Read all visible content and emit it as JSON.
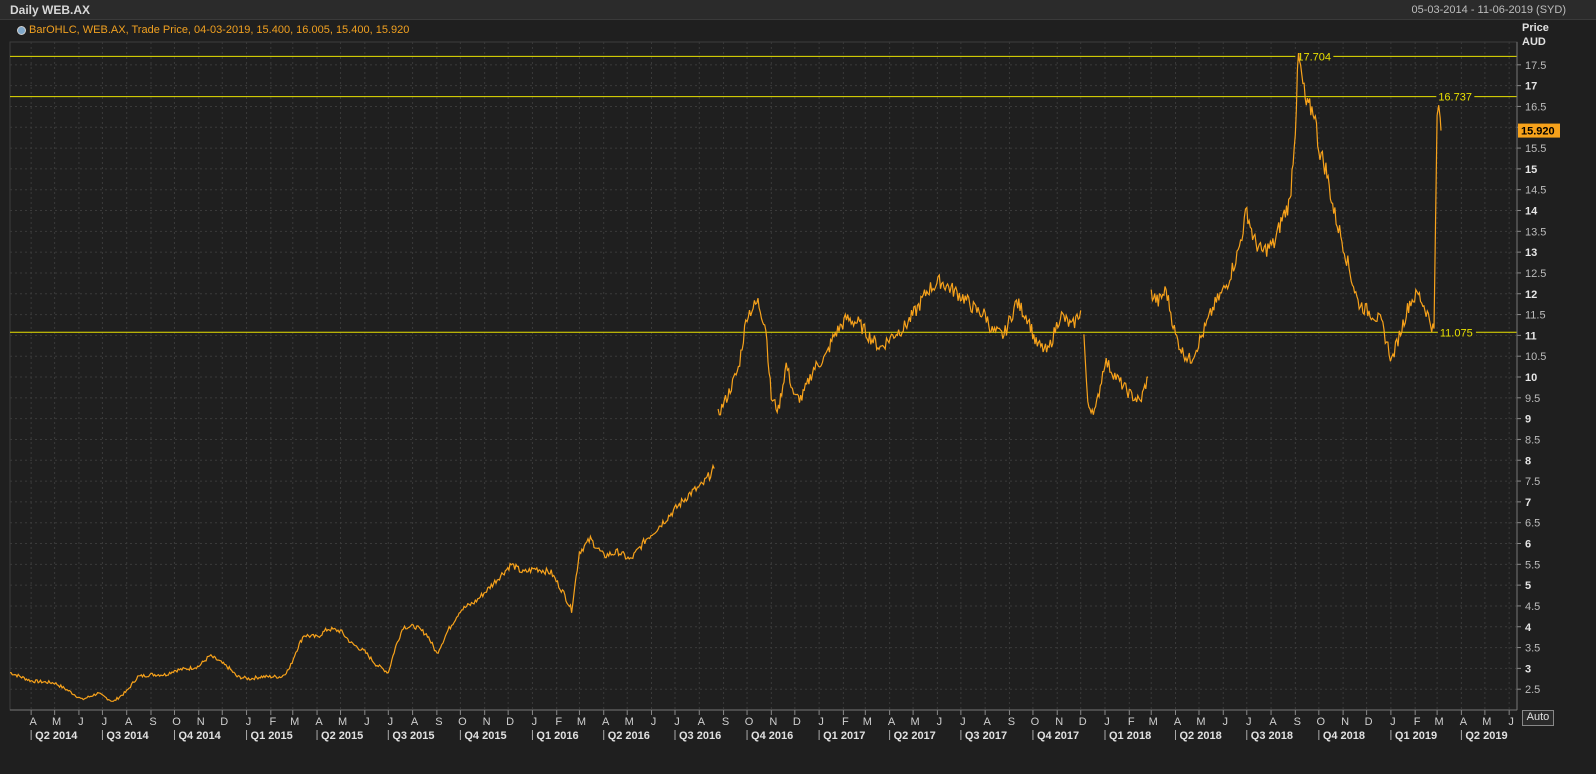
{
  "header": {
    "title": "Daily WEB.AX",
    "range": "05-03-2014 - 11-06-2019 (SYD)",
    "legend": "BarOHLC, WEB.AX, Trade Price, 04-03-2019, 15.400, 16.005, 15.400, 15.920"
  },
  "axis": {
    "price_label": "Price",
    "currency_label": "AUD",
    "auto_label": "Auto"
  },
  "colors": {
    "series": "#f7a21b",
    "hline": "#e8e000",
    "grid": "#3a3a3a",
    "background": "#1f1f1f",
    "last_price_bg": "#f7a21b"
  },
  "chart_data": {
    "type": "line",
    "title": "Daily WEB.AX",
    "series_name": "WEB.AX Trade Price",
    "ylim": [
      2,
      18
    ],
    "yticks": [
      2.5,
      3,
      3.5,
      4,
      4.5,
      5,
      5.5,
      6,
      6.5,
      7,
      7.5,
      8,
      8.5,
      9,
      9.5,
      10,
      10.5,
      11,
      11.5,
      12,
      12.5,
      13,
      13.5,
      14,
      14.5,
      15,
      15.5,
      16,
      16.5,
      17,
      17.5
    ],
    "ytick_labels": [
      "2.5",
      "3",
      "3.5",
      "4",
      "4.5",
      "5",
      "5.5",
      "6",
      "6.5",
      "7",
      "7.5",
      "8",
      "8.5",
      "9",
      "9.5",
      "10",
      "10.5",
      "11",
      "11.5",
      "12",
      "12.5",
      "13",
      "13.5",
      "14",
      "14.5",
      "15",
      "15.5",
      "16",
      "16.5",
      "17",
      "17.5"
    ],
    "last_price": 15.92,
    "last_price_label": "15.920",
    "hlines": [
      {
        "value": 17.704,
        "label": "17.704",
        "x": "2018-09-01"
      },
      {
        "value": 16.737,
        "label": "16.737",
        "x": "2019-02-28"
      },
      {
        "value": 11.075,
        "label": "11.075",
        "x": "2019-03-02"
      }
    ],
    "x_start": "2014-03-05",
    "x_end": "2019-06-11",
    "month_labels": [
      {
        "d": "2014-04-01",
        "l": "A"
      },
      {
        "d": "2014-05-01",
        "l": "M"
      },
      {
        "d": "2014-06-01",
        "l": "J"
      },
      {
        "d": "2014-07-01",
        "l": "J"
      },
      {
        "d": "2014-08-01",
        "l": "A"
      },
      {
        "d": "2014-09-01",
        "l": "S"
      },
      {
        "d": "2014-10-01",
        "l": "O"
      },
      {
        "d": "2014-11-01",
        "l": "N"
      },
      {
        "d": "2014-12-01",
        "l": "D"
      },
      {
        "d": "2015-01-01",
        "l": "J"
      },
      {
        "d": "2015-02-01",
        "l": "F"
      },
      {
        "d": "2015-03-01",
        "l": "M"
      },
      {
        "d": "2015-04-01",
        "l": "A"
      },
      {
        "d": "2015-05-01",
        "l": "M"
      },
      {
        "d": "2015-06-01",
        "l": "J"
      },
      {
        "d": "2015-07-01",
        "l": "J"
      },
      {
        "d": "2015-08-01",
        "l": "A"
      },
      {
        "d": "2015-09-01",
        "l": "S"
      },
      {
        "d": "2015-10-01",
        "l": "O"
      },
      {
        "d": "2015-11-01",
        "l": "N"
      },
      {
        "d": "2015-12-01",
        "l": "D"
      },
      {
        "d": "2016-01-01",
        "l": "J"
      },
      {
        "d": "2016-02-01",
        "l": "F"
      },
      {
        "d": "2016-03-01",
        "l": "M"
      },
      {
        "d": "2016-04-01",
        "l": "A"
      },
      {
        "d": "2016-05-01",
        "l": "M"
      },
      {
        "d": "2016-06-01",
        "l": "J"
      },
      {
        "d": "2016-07-01",
        "l": "J"
      },
      {
        "d": "2016-08-01",
        "l": "A"
      },
      {
        "d": "2016-09-01",
        "l": "S"
      },
      {
        "d": "2016-10-01",
        "l": "O"
      },
      {
        "d": "2016-11-01",
        "l": "N"
      },
      {
        "d": "2016-12-01",
        "l": "D"
      },
      {
        "d": "2017-01-01",
        "l": "J"
      },
      {
        "d": "2017-02-01",
        "l": "F"
      },
      {
        "d": "2017-03-01",
        "l": "M"
      },
      {
        "d": "2017-04-01",
        "l": "A"
      },
      {
        "d": "2017-05-01",
        "l": "M"
      },
      {
        "d": "2017-06-01",
        "l": "J"
      },
      {
        "d": "2017-07-01",
        "l": "J"
      },
      {
        "d": "2017-08-01",
        "l": "A"
      },
      {
        "d": "2017-09-01",
        "l": "S"
      },
      {
        "d": "2017-10-01",
        "l": "O"
      },
      {
        "d": "2017-11-01",
        "l": "N"
      },
      {
        "d": "2017-12-01",
        "l": "D"
      },
      {
        "d": "2018-01-01",
        "l": "J"
      },
      {
        "d": "2018-02-01",
        "l": "F"
      },
      {
        "d": "2018-03-01",
        "l": "M"
      },
      {
        "d": "2018-04-01",
        "l": "A"
      },
      {
        "d": "2018-05-01",
        "l": "M"
      },
      {
        "d": "2018-06-01",
        "l": "J"
      },
      {
        "d": "2018-07-01",
        "l": "J"
      },
      {
        "d": "2018-08-01",
        "l": "A"
      },
      {
        "d": "2018-09-01",
        "l": "S"
      },
      {
        "d": "2018-10-01",
        "l": "O"
      },
      {
        "d": "2018-11-01",
        "l": "N"
      },
      {
        "d": "2018-12-01",
        "l": "D"
      },
      {
        "d": "2019-01-01",
        "l": "J"
      },
      {
        "d": "2019-02-01",
        "l": "F"
      },
      {
        "d": "2019-03-01",
        "l": "M"
      },
      {
        "d": "2019-04-01",
        "l": "A"
      },
      {
        "d": "2019-05-01",
        "l": "M"
      },
      {
        "d": "2019-06-01",
        "l": "J"
      }
    ],
    "quarter_labels": [
      {
        "d": "2014-04-01",
        "l": "Q2 2014"
      },
      {
        "d": "2014-07-01",
        "l": "Q3 2014"
      },
      {
        "d": "2014-10-01",
        "l": "Q4 2014"
      },
      {
        "d": "2015-01-01",
        "l": "Q1 2015"
      },
      {
        "d": "2015-04-01",
        "l": "Q2 2015"
      },
      {
        "d": "2015-07-01",
        "l": "Q3 2015"
      },
      {
        "d": "2015-10-01",
        "l": "Q4 2015"
      },
      {
        "d": "2016-01-01",
        "l": "Q1 2016"
      },
      {
        "d": "2016-04-01",
        "l": "Q2 2016"
      },
      {
        "d": "2016-07-01",
        "l": "Q3 2016"
      },
      {
        "d": "2016-10-01",
        "l": "Q4 2016"
      },
      {
        "d": "2017-01-01",
        "l": "Q1 2017"
      },
      {
        "d": "2017-04-01",
        "l": "Q2 2017"
      },
      {
        "d": "2017-07-01",
        "l": "Q3 2017"
      },
      {
        "d": "2017-10-01",
        "l": "Q4 2017"
      },
      {
        "d": "2018-01-01",
        "l": "Q1 2018"
      },
      {
        "d": "2018-04-01",
        "l": "Q2 2018"
      },
      {
        "d": "2018-07-01",
        "l": "Q3 2018"
      },
      {
        "d": "2018-10-01",
        "l": "Q4 2018"
      },
      {
        "d": "2019-01-01",
        "l": "Q1 2019"
      },
      {
        "d": "2019-04-01",
        "l": "Q2 2019"
      }
    ],
    "segments": [
      [
        [
          "2014-03-05",
          2.9
        ],
        [
          "2014-04-01",
          2.7
        ],
        [
          "2014-05-01",
          2.65
        ],
        [
          "2014-05-20",
          2.45
        ],
        [
          "2014-06-05",
          2.25
        ],
        [
          "2014-06-25",
          2.4
        ],
        [
          "2014-07-15",
          2.2
        ],
        [
          "2014-08-01",
          2.45
        ],
        [
          "2014-08-15",
          2.8
        ],
        [
          "2014-09-01",
          2.85
        ],
        [
          "2014-09-20",
          2.85
        ],
        [
          "2014-10-01",
          2.95
        ],
        [
          "2014-10-20",
          3.0
        ],
        [
          "2014-11-01",
          3.05
        ],
        [
          "2014-11-15",
          3.3
        ],
        [
          "2014-11-25",
          3.2
        ],
        [
          "2014-12-10",
          3.0
        ],
        [
          "2014-12-20",
          2.8
        ],
        [
          "2015-01-05",
          2.75
        ],
        [
          "2015-01-20",
          2.8
        ],
        [
          "2015-02-15",
          2.8
        ],
        [
          "2015-02-25",
          3.0
        ],
        [
          "2015-03-05",
          3.4
        ],
        [
          "2015-03-15",
          3.8
        ],
        [
          "2015-04-01",
          3.75
        ],
        [
          "2015-04-15",
          3.95
        ],
        [
          "2015-05-01",
          3.9
        ],
        [
          "2015-05-15",
          3.6
        ],
        [
          "2015-06-01",
          3.4
        ],
        [
          "2015-06-15",
          3.1
        ],
        [
          "2015-07-01",
          2.9
        ],
        [
          "2015-07-10",
          3.5
        ],
        [
          "2015-07-20",
          4.0
        ],
        [
          "2015-08-05",
          4.0
        ],
        [
          "2015-08-20",
          3.8
        ],
        [
          "2015-09-01",
          3.35
        ],
        [
          "2015-09-15",
          3.9
        ],
        [
          "2015-10-01",
          4.4
        ],
        [
          "2015-10-20",
          4.6
        ],
        [
          "2015-11-05",
          4.9
        ],
        [
          "2015-11-20",
          5.2
        ],
        [
          "2015-12-05",
          5.5
        ],
        [
          "2015-12-20",
          5.3
        ],
        [
          "2016-01-05",
          5.4
        ],
        [
          "2016-01-25",
          5.3
        ],
        [
          "2016-02-10",
          4.8
        ],
        [
          "2016-02-20",
          4.4
        ],
        [
          "2016-03-01",
          5.8
        ],
        [
          "2016-03-15",
          6.1
        ],
        [
          "2016-04-01",
          5.7
        ],
        [
          "2016-04-20",
          5.8
        ],
        [
          "2016-05-05",
          5.6
        ],
        [
          "2016-05-25",
          6.1
        ],
        [
          "2016-06-05",
          6.3
        ],
        [
          "2016-06-20",
          6.6
        ],
        [
          "2016-07-05",
          6.9
        ],
        [
          "2016-07-20",
          7.2
        ],
        [
          "2016-08-05",
          7.4
        ],
        [
          "2016-08-20",
          7.8
        ]
      ],
      [
        [
          "2016-08-25",
          9.1
        ],
        [
          "2016-09-05",
          9.5
        ],
        [
          "2016-09-20",
          10.2
        ],
        [
          "2016-10-01",
          11.5
        ],
        [
          "2016-10-15",
          11.8
        ],
        [
          "2016-10-25",
          11.2
        ],
        [
          "2016-11-01",
          9.5
        ],
        [
          "2016-11-10",
          9.2
        ],
        [
          "2016-11-20",
          10.3
        ],
        [
          "2016-12-01",
          9.5
        ],
        [
          "2016-12-10",
          9.5
        ],
        [
          "2016-12-25",
          10.2
        ],
        [
          "2017-01-10",
          10.5
        ],
        [
          "2017-01-20",
          11.0
        ],
        [
          "2017-02-05",
          11.4
        ],
        [
          "2017-02-20",
          11.3
        ],
        [
          "2017-03-05",
          11.0
        ],
        [
          "2017-03-20",
          10.7
        ],
        [
          "2017-04-05",
          11.0
        ],
        [
          "2017-04-20",
          11.2
        ],
        [
          "2017-05-05",
          11.6
        ],
        [
          "2017-05-20",
          12.1
        ],
        [
          "2017-06-05",
          12.3
        ],
        [
          "2017-06-20",
          12.1
        ],
        [
          "2017-07-05",
          11.9
        ],
        [
          "2017-07-20",
          11.6
        ],
        [
          "2017-08-01",
          11.5
        ],
        [
          "2017-08-10",
          11.1
        ],
        [
          "2017-08-25",
          11.0
        ],
        [
          "2017-09-10",
          11.8
        ],
        [
          "2017-09-25",
          11.4
        ],
        [
          "2017-10-05",
          10.8
        ],
        [
          "2017-10-20",
          10.6
        ],
        [
          "2017-11-05",
          11.5
        ],
        [
          "2017-11-20",
          11.2
        ],
        [
          "2017-12-01",
          11.6
        ]
      ],
      [
        [
          "2017-12-05",
          11.0
        ],
        [
          "2017-12-10",
          9.3
        ],
        [
          "2017-12-20",
          9.2
        ],
        [
          "2018-01-01",
          10.4
        ],
        [
          "2018-01-15",
          10.0
        ],
        [
          "2018-02-01",
          9.6
        ],
        [
          "2018-02-15",
          9.4
        ],
        [
          "2018-02-25",
          10.0
        ]
      ],
      [
        [
          "2018-03-01",
          12.0
        ],
        [
          "2018-03-10",
          11.8
        ],
        [
          "2018-03-20",
          12.1
        ],
        [
          "2018-04-01",
          11.0
        ],
        [
          "2018-04-10",
          10.6
        ],
        [
          "2018-04-20",
          10.4
        ],
        [
          "2018-05-05",
          11.0
        ],
        [
          "2018-05-20",
          11.7
        ],
        [
          "2018-06-05",
          12.2
        ],
        [
          "2018-06-20",
          13.0
        ],
        [
          "2018-07-01",
          14.0
        ],
        [
          "2018-07-10",
          13.3
        ],
        [
          "2018-07-20",
          13.0
        ],
        [
          "2018-08-05",
          13.2
        ],
        [
          "2018-08-15",
          13.8
        ],
        [
          "2018-08-25",
          14.2
        ],
        [
          "2018-09-01",
          16.0
        ],
        [
          "2018-09-05",
          17.7
        ],
        [
          "2018-09-15",
          16.5
        ],
        [
          "2018-09-25",
          16.4
        ],
        [
          "2018-10-01",
          15.5
        ],
        [
          "2018-10-10",
          15.0
        ],
        [
          "2018-10-20",
          14.0
        ],
        [
          "2018-11-01",
          13.2
        ],
        [
          "2018-11-10",
          12.5
        ],
        [
          "2018-11-20",
          11.8
        ],
        [
          "2018-12-01",
          11.6
        ],
        [
          "2018-12-10",
          11.5
        ],
        [
          "2018-12-20",
          11.3
        ],
        [
          "2019-01-02",
          10.4
        ],
        [
          "2019-01-15",
          11.2
        ],
        [
          "2019-01-25",
          11.8
        ],
        [
          "2019-02-05",
          12.0
        ],
        [
          "2019-02-15",
          11.6
        ],
        [
          "2019-02-25",
          11.1
        ],
        [
          "2019-02-27",
          13.6
        ],
        [
          "2019-03-01",
          16.2
        ],
        [
          "2019-03-03",
          16.6
        ],
        [
          "2019-03-05",
          16.0
        ],
        [
          "2019-03-06",
          15.92
        ]
      ]
    ]
  }
}
